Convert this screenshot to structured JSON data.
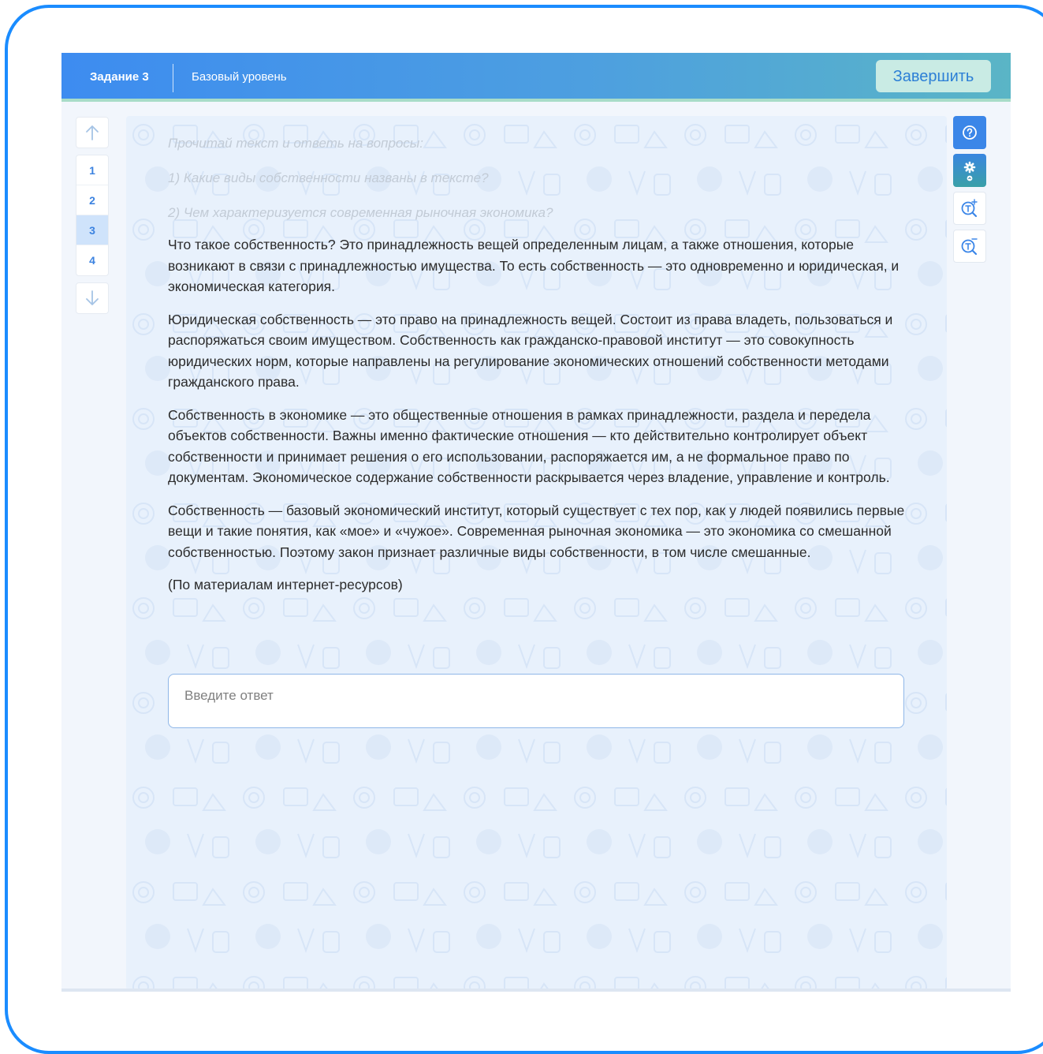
{
  "header": {
    "task_title": "Задание 3",
    "level": "Базовый уровень",
    "finish_label": "Завершить"
  },
  "nav": {
    "up_icon": "arrow-up-icon",
    "down_icon": "arrow-down-icon",
    "items": [
      "1",
      "2",
      "3",
      "4"
    ],
    "active_index": 2
  },
  "tools": {
    "help_icon": "help-circle-icon",
    "settings_icon": "gear-icon",
    "zoom_in_icon": "zoom-in-text-icon",
    "zoom_out_icon": "zoom-out-text-icon"
  },
  "content": {
    "instructions": [
      "Прочитай текст и ответь на вопросы:",
      "1) Какие виды собственности названы в тексте?",
      "2) Чем характеризуется современная рыночная экономика?"
    ],
    "paragraphs": [
      "Что такое собственность? Это принадлежность вещей определенным лицам, а также отношения, которые возникают в связи с принадлежностью имущества. То есть собственность — это одновременно и юридическая, и экономическая категория.",
      "Юридическая собственность — это право на принадлежность вещей. Состоит из права владеть, пользоваться и распоряжаться своим имуществом. Собственность как гражданско-правовой институт — это совокупность юридических норм, которые направлены на регулирование экономических отношений собственности методами гражданского права.",
      "Собственность в экономике — это общественные отношения в рамках принадлежности, раздела и передела объектов собственности. Важны именно фактические отношения — кто действительно контролирует объект собственности и принимает решения о его использовании, распоряжается им, а не формальное право по документам. Экономическое содержание собственности раскрывается через владение, управление и контроль.",
      "Собственность — базовый экономический институт, который существует с тех пор, как у людей появились первые вещи и такие понятия, как «мое» и «чужое». Современная рыночная экономика — это экономика со смешанной собственностью. Поэтому закон признает различные виды собственности, в том числе смешанные.",
      "(По материалам интернет-ресурсов)"
    ],
    "answer_placeholder": "Введите ответ",
    "answer_value": ""
  },
  "colors": {
    "frame_border": "#1a8cff",
    "header_start": "#3d8cf0",
    "header_end": "#5ab5c6",
    "accent": "#3b82e0",
    "content_bg": "#e8f1fc"
  }
}
